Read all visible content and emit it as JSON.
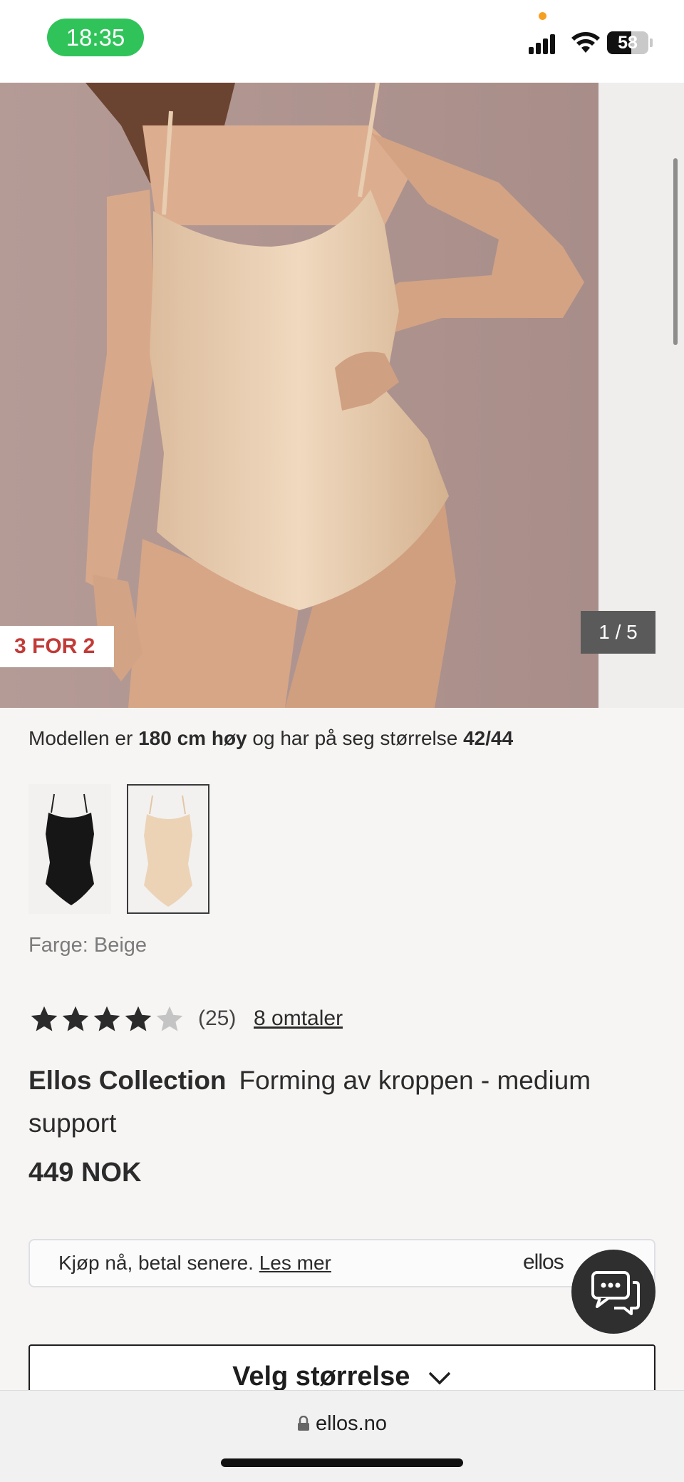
{
  "status": {
    "time": "18:35",
    "battery": "58"
  },
  "gallery": {
    "badge": "3 FOR 2",
    "counter": "1 / 5"
  },
  "model": {
    "prefix": "Modellen er ",
    "height": "180 cm høy",
    "middle": " og har på seg størrelse ",
    "size": "42/44"
  },
  "colors": {
    "label": "Farge: Beige",
    "options": [
      "black",
      "beige"
    ],
    "selected": "beige"
  },
  "rating": {
    "stars": 4,
    "max": 5,
    "count": "(25)",
    "reviews_link": "8 omtaler"
  },
  "product": {
    "brand": "Ellos Collection",
    "name": "Forming av kroppen - medium support",
    "price": "449 NOK"
  },
  "bnpl": {
    "text": "Kjøp nå, betal senere. ",
    "link": "Les mer",
    "logo": "ellos"
  },
  "size_button": {
    "label": "Velg størrelse"
  },
  "browser": {
    "url": "ellos.no"
  },
  "palette": {
    "accent_red": "#c23a37",
    "status_green": "#30c35a",
    "skin": "#d9ad8e",
    "beige": "#ecd3b6"
  }
}
